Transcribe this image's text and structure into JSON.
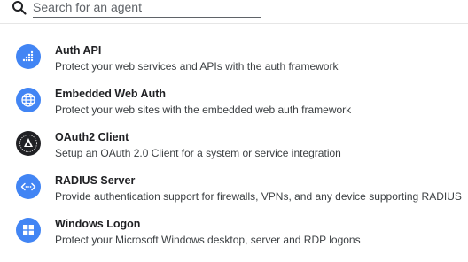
{
  "search": {
    "placeholder": "Search for an agent",
    "icon": "search-icon"
  },
  "colors": {
    "accent": "#4285f4",
    "oauth_icon_bg": "#202124"
  },
  "agents": [
    {
      "name": "Auth API",
      "description": "Protect your web services and APIs with the auth framework",
      "icon": "api-dots-icon"
    },
    {
      "name": "Embedded Web Auth",
      "description": "Protect your web sites with the embedded web auth framework",
      "icon": "globe-icon"
    },
    {
      "name": "OAuth2 Client",
      "description": "Setup an OAuth 2.0 Client for a system or service integration",
      "icon": "oauth-logo-icon"
    },
    {
      "name": "RADIUS Server",
      "description": "Provide authentication support for firewalls, VPNs, and any device supporting RADIUS",
      "icon": "code-arrows-icon"
    },
    {
      "name": "Windows Logon",
      "description": "Protect your Microsoft Windows desktop, server and RDP logons",
      "icon": "windows-logo-icon"
    }
  ]
}
